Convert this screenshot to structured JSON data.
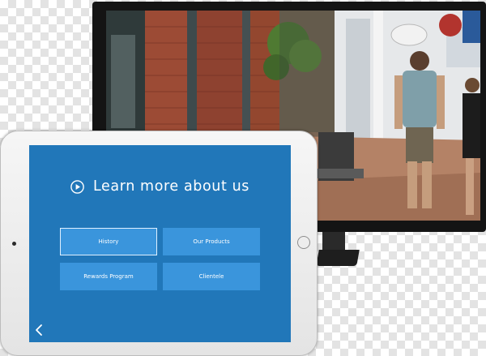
{
  "tablet_app": {
    "heading": "Learn more about us",
    "buttons": [
      {
        "label": "History",
        "selected": true
      },
      {
        "label": "Our Products",
        "selected": false
      },
      {
        "label": "Rewards Program",
        "selected": false
      },
      {
        "label": "Clientele",
        "selected": false
      }
    ],
    "icons": {
      "play": "play-circle-icon",
      "back": "chevron-left-icon"
    }
  },
  "colors": {
    "screen_bg": "#2177b9",
    "button_bg": "#3a95dc",
    "selected_border": "#dff0ff"
  }
}
